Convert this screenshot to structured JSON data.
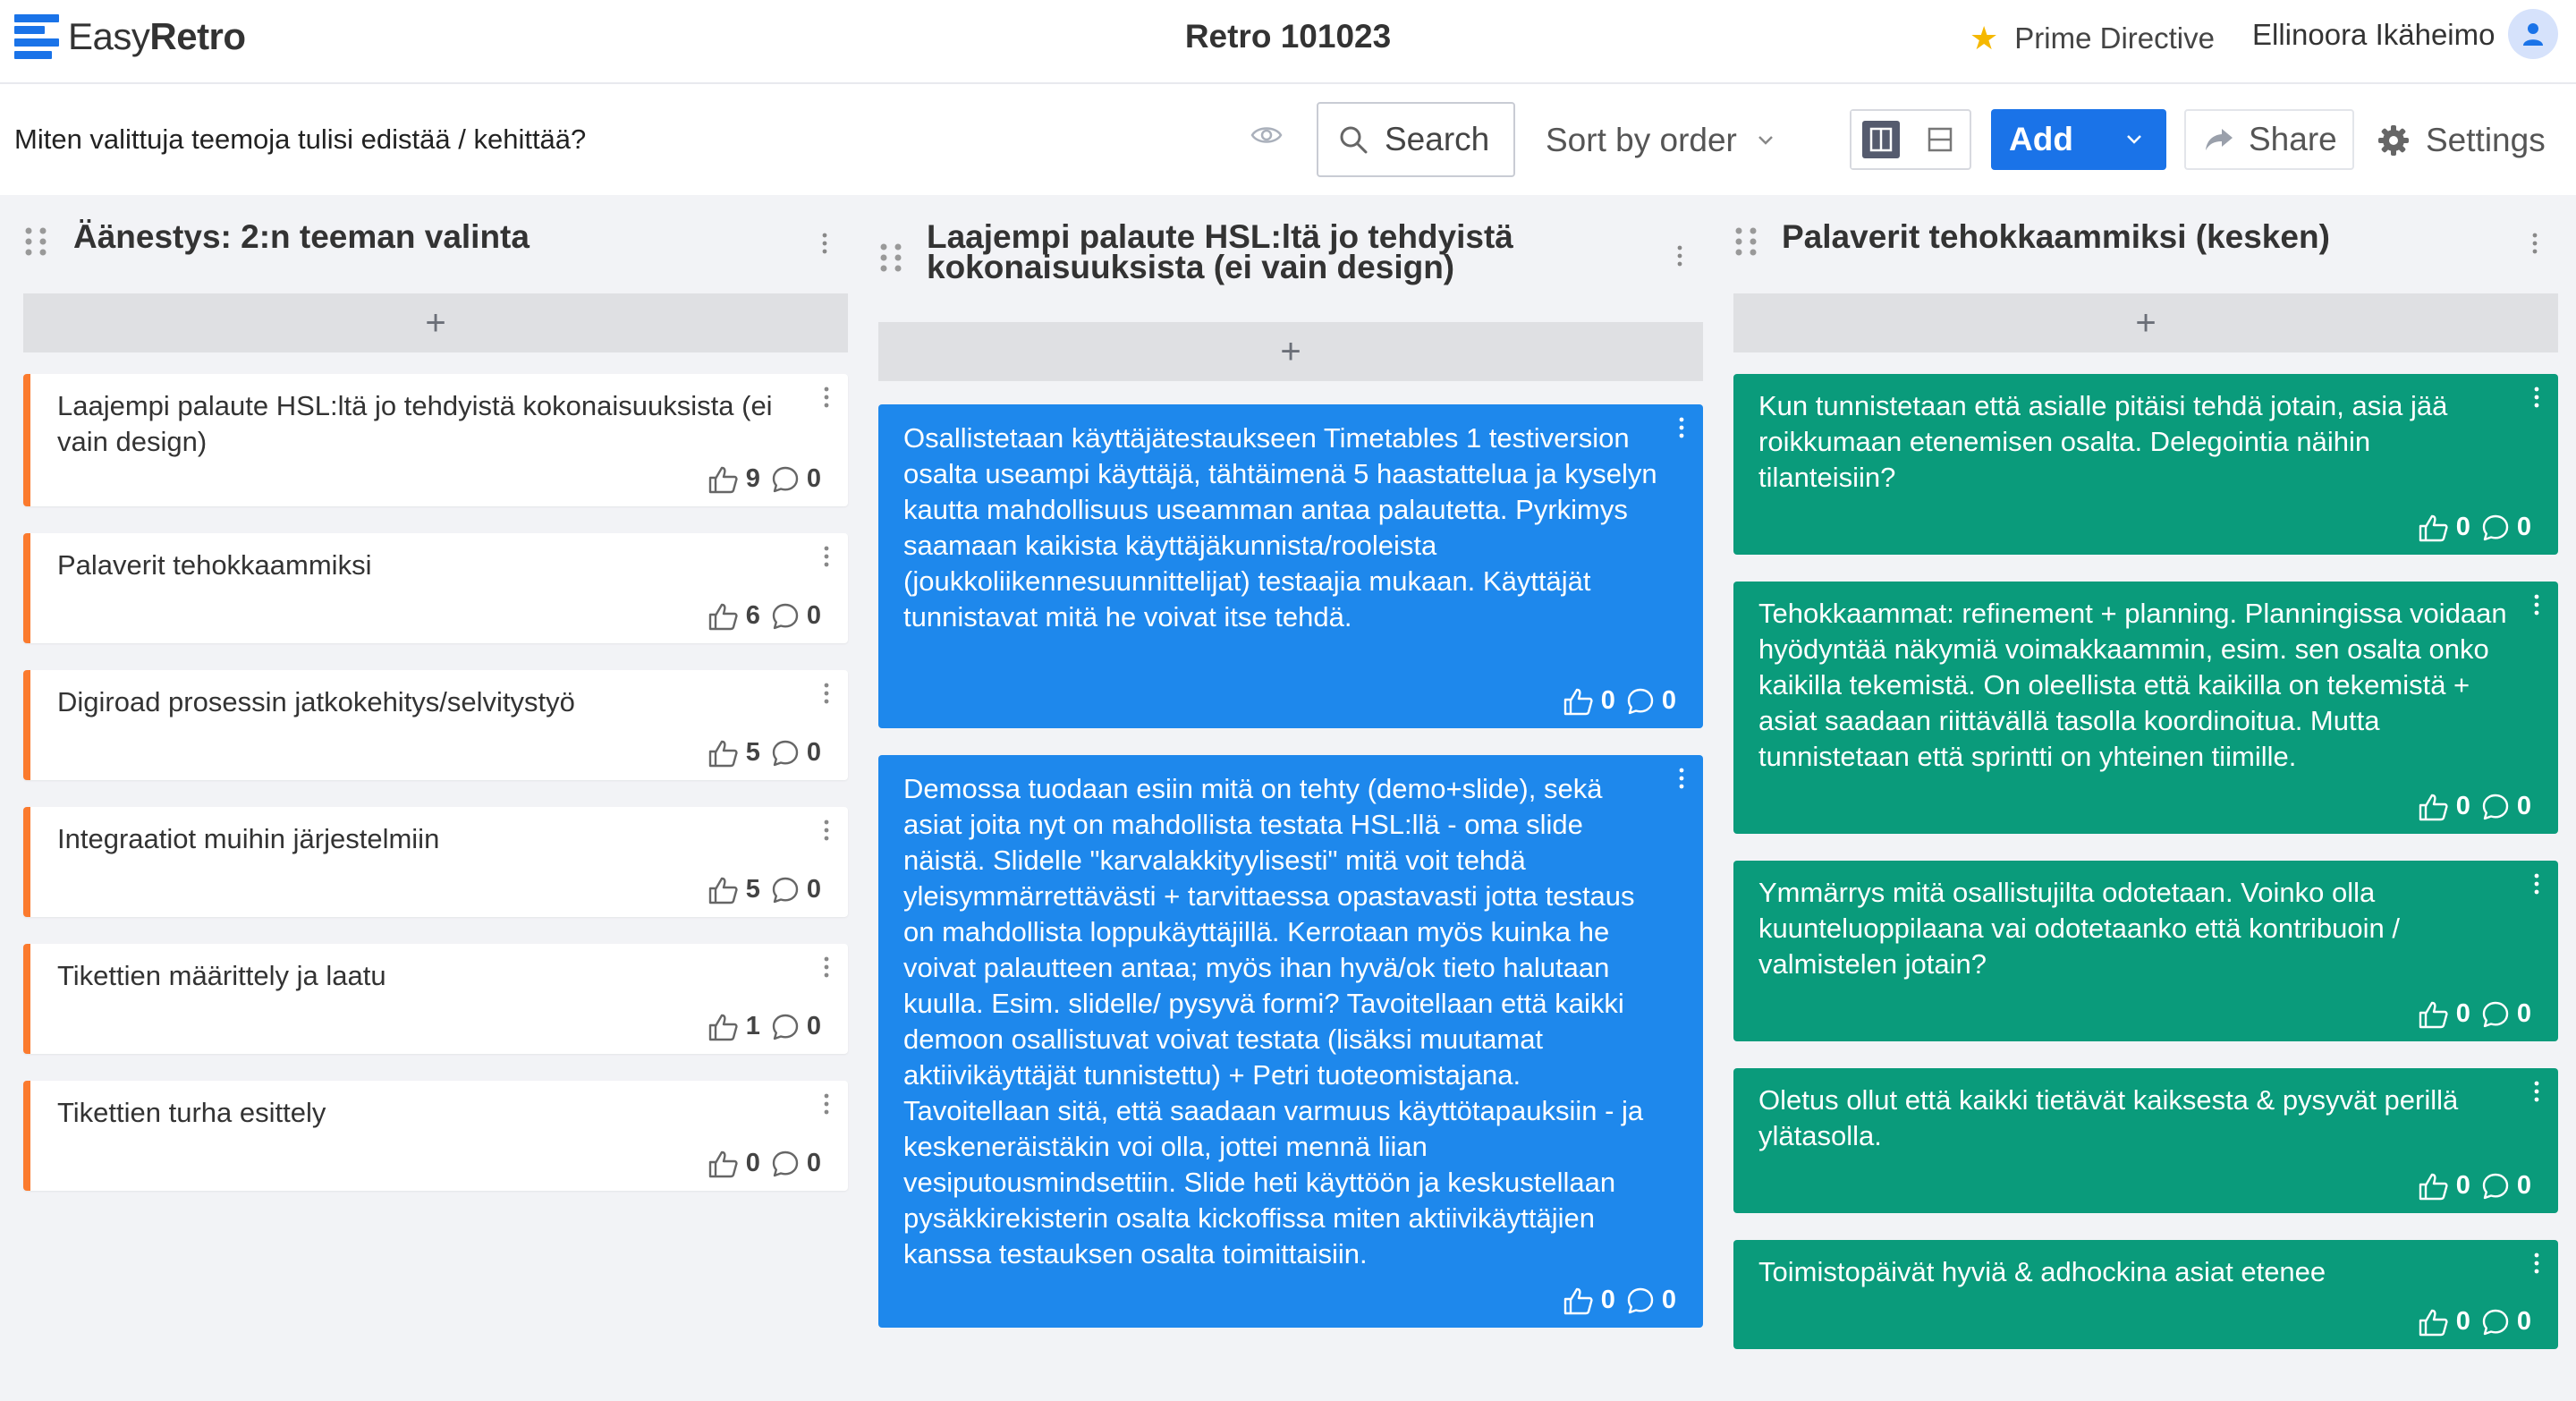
{
  "app": {
    "logo_light": "Easy",
    "logo_bold": "Retro"
  },
  "board_title": "Retro 101023",
  "header": {
    "prime_directive": "Prime Directive",
    "user_name": "Ellinoora Ikäheimo"
  },
  "toolbar": {
    "question": "Miten valittuja teemoja tulisi edistää / kehittää?",
    "search_label": "Search",
    "sort_label": "Sort by order",
    "add_label": "Add",
    "share_label": "Share",
    "settings_label": "Settings"
  },
  "colors": {
    "accent": "#1a73e8",
    "orange": "#fb7a2e",
    "blue_card": "#1e88ec",
    "green_card": "#0a9b7b"
  },
  "columns": [
    {
      "title": "Äänestys: 2:n teeman valinta",
      "add_label": "+",
      "cards": [
        {
          "text": "Laajempi palaute HSL:ltä jo tehdyistä kokonaisuuksista (ei vain design)",
          "likes": "9",
          "comments": "0"
        },
        {
          "text": "Palaverit tehokkaammiksi",
          "likes": "6",
          "comments": "0"
        },
        {
          "text": "Digiroad prosessin jatkokehitys/selvitystyö",
          "likes": "5",
          "comments": "0"
        },
        {
          "text": "Integraatiot muihin järjestelmiin",
          "likes": "5",
          "comments": "0"
        },
        {
          "text": "Tikettien määrittely ja laatu",
          "likes": "1",
          "comments": "0"
        },
        {
          "text": "Tikettien turha esittely",
          "likes": "0",
          "comments": "0"
        }
      ]
    },
    {
      "title": "Laajempi palaute HSL:ltä jo tehdyistä kokonaisuuksista (ei vain design)",
      "add_label": "+",
      "cards": [
        {
          "text": "Osallistetaan käyttäjätestaukseen Timetables 1 testiversion osalta useampi käyttäjä, tähtäimenä 5 haastattelua ja kyselyn kautta mahdollisuus useamman antaa palautetta. Pyrkimys saamaan kaikista käyttäjäkunnista/rooleista (joukkoliikennesuunnittelijat) testaajia mukaan. Käyttäjät tunnistavat mitä he voivat itse tehdä.",
          "likes": "0",
          "comments": "0"
        },
        {
          "text": "Demossa tuodaan esiin mitä on tehty (demo+slide), sekä asiat joita nyt on mahdollista testata HSL:llä - oma slide näistä. Slidelle \"karvalakkityylisesti\" mitä voit tehdä yleisymmärrettävästi + tarvittaessa opastavasti jotta testaus on mahdollista loppukäyttäjillä. Kerrotaan myös kuinka he voivat palautteen antaa; myös ihan hyvä/ok tieto halutaan kuulla. Esim. slidelle/ pysyvä formi? Tavoitellaan että kaikki demoon osallistuvat voivat testata (lisäksi muutamat aktiivikäyttäjät tunnistettu) + Petri tuoteomistajana. Tavoitellaan sitä, että saadaan varmuus käyttötapauksiin - ja keskeneräistäkin voi olla, jottei mennä liian vesiputousmindsettiin. Slide heti käyttöön ja keskustellaan pysäkkirekisterin osalta kickoffissa miten aktiivikäyttäjien kanssa testauksen osalta toimittaisiin.",
          "likes": "0",
          "comments": "0"
        }
      ]
    },
    {
      "title": "Palaverit tehokkaammiksi (kesken)",
      "add_label": "+",
      "cards": [
        {
          "text": "Kun tunnistetaan että asialle pitäisi tehdä jotain, asia jää roikkumaan etenemisen osalta. Delegointia näihin tilanteisiin?",
          "likes": "0",
          "comments": "0"
        },
        {
          "text": "Tehokkaammat: refinement + planning. Planningissa voidaan hyödyntää näkymiä voimakkaammin, esim. sen osalta onko kaikilla tekemistä. On oleellista että kaikilla on tekemistä + asiat saadaan riittävällä tasolla koordinoitua. Mutta tunnistetaan että sprintti on yhteinen tiimille.",
          "likes": "0",
          "comments": "0"
        },
        {
          "text": "Ymmärrys mitä osallistujilta odotetaan. Voinko olla kuunteluoppilaana vai odotetaanko että kontribuoin / valmistelen jotain?",
          "likes": "0",
          "comments": "0"
        },
        {
          "text": "Oletus ollut että kaikki tietävät kaiksesta & pysyvät perillä ylätasolla.",
          "likes": "0",
          "comments": "0"
        },
        {
          "text": "Toimistopäivät hyviä & adhockina asiat etenee",
          "likes": "0",
          "comments": "0"
        }
      ]
    }
  ]
}
